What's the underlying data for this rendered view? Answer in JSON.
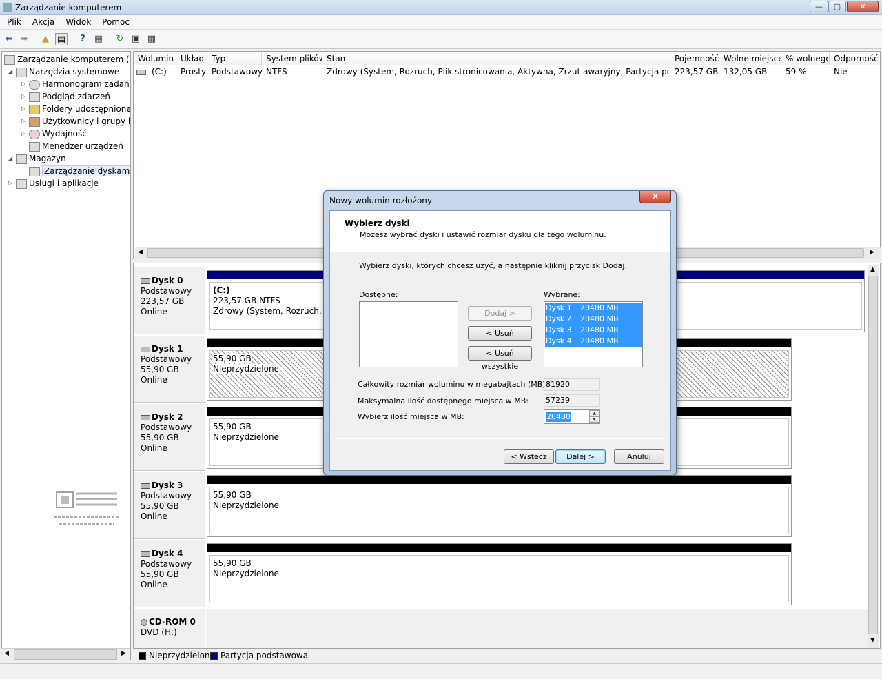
{
  "window": {
    "title": "Zarządzanie komputerem",
    "controls": {
      "minimize": "—",
      "maximize": "▢",
      "close": "✕"
    }
  },
  "menu": [
    "Plik",
    "Akcja",
    "Widok",
    "Pomoc"
  ],
  "tree": {
    "root": "Zarządzanie komputerem (loka",
    "system_tools": "Narzędzia systemowe",
    "task_scheduler": "Harmonogram zadań",
    "event_viewer": "Podgląd zdarzeń",
    "shared_folders": "Foldery udostępnione",
    "local_users": "Użytkownicy i grupy lok",
    "performance": "Wydajność",
    "device_manager": "Menedżer urządzeń",
    "storage": "Magazyn",
    "disk_management": "Zarządzanie dyskami",
    "services": "Usługi i aplikacje"
  },
  "volume_table": {
    "headers": [
      "Wolumin",
      "Układ",
      "Typ",
      "System plików",
      "Stan",
      "Pojemność",
      "Wolne miejsce",
      "% wolnego",
      "Odporność"
    ],
    "row": [
      "(C:)",
      "Prosty",
      "Podstawowy",
      "NTFS",
      "Zdrowy (System, Rozruch, Plik stronicowania, Aktywna, Zrzut awaryjny, Partycja podstawowa)",
      "223,57 GB",
      "132,05 GB",
      "59 %",
      "Nie"
    ]
  },
  "disks": [
    {
      "name": "Dysk 0",
      "type": "Podstawowy",
      "size": "223,57 GB",
      "status": "Online",
      "part_title": "(C:)",
      "part_size": "223,57 GB NTFS",
      "part_status": "Zdrowy (System, Rozruch, Plik"
    },
    {
      "name": "Dysk 1",
      "type": "Podstawowy",
      "size": "55,90 GB",
      "status": "Online",
      "part_size": "55,90 GB",
      "part_status": "Nieprzydzielone"
    },
    {
      "name": "Dysk 2",
      "type": "Podstawowy",
      "size": "55,90 GB",
      "status": "Online",
      "part_size": "55,90 GB",
      "part_status": "Nieprzydzielone"
    },
    {
      "name": "Dysk 3",
      "type": "Podstawowy",
      "size": "55,90 GB",
      "status": "Online",
      "part_size": "55,90 GB",
      "part_status": "Nieprzydzielone"
    },
    {
      "name": "Dysk 4",
      "type": "Podstawowy",
      "size": "55,90 GB",
      "status": "Online",
      "part_size": "55,90 GB",
      "part_status": "Nieprzydzielone"
    }
  ],
  "cdrom": {
    "name": "CD-ROM 0",
    "type": "DVD (H:)"
  },
  "legend": {
    "unallocated": "Nieprzydzielone",
    "primary": "Partycja podstawowa"
  },
  "colors": {
    "primary_partition": "#000080",
    "unallocated": "#000000",
    "selection": "#3399ff"
  },
  "dialog": {
    "title": "Nowy wolumin rozłożony",
    "heading": "Wybierz dyski",
    "subheading": "Możesz wybrać dyski i ustawić rozmiar dysku dla tego woluminu.",
    "instruction": "Wybierz dyski, których chcesz użyć, a następnie kliknij przycisk Dodaj.",
    "available_label": "Dostępne:",
    "selected_label": "Wybrane:",
    "selected_items": [
      {
        "disk": "Dysk 1",
        "size": "20480 MB"
      },
      {
        "disk": "Dysk 2",
        "size": "20480 MB"
      },
      {
        "disk": "Dysk 3",
        "size": "20480 MB"
      },
      {
        "disk": "Dysk 4",
        "size": "20480 MB"
      }
    ],
    "add_button": "Dodaj >",
    "remove_button": "< Usuń",
    "remove_all_button": "< Usuń wszystkie",
    "total_label": "Całkowity rozmiar woluminu w megabajtach (MB):",
    "total_value": "81920",
    "max_label": "Maksymalna ilość dostępnego miejsca w MB:",
    "max_value": "57239",
    "choose_label": "Wybierz ilość miejsca w MB:",
    "choose_value": "20480",
    "back_button": "< Wstecz",
    "next_button": "Dalej >",
    "cancel_button": "Anuluj",
    "close_glyph": "✕"
  }
}
